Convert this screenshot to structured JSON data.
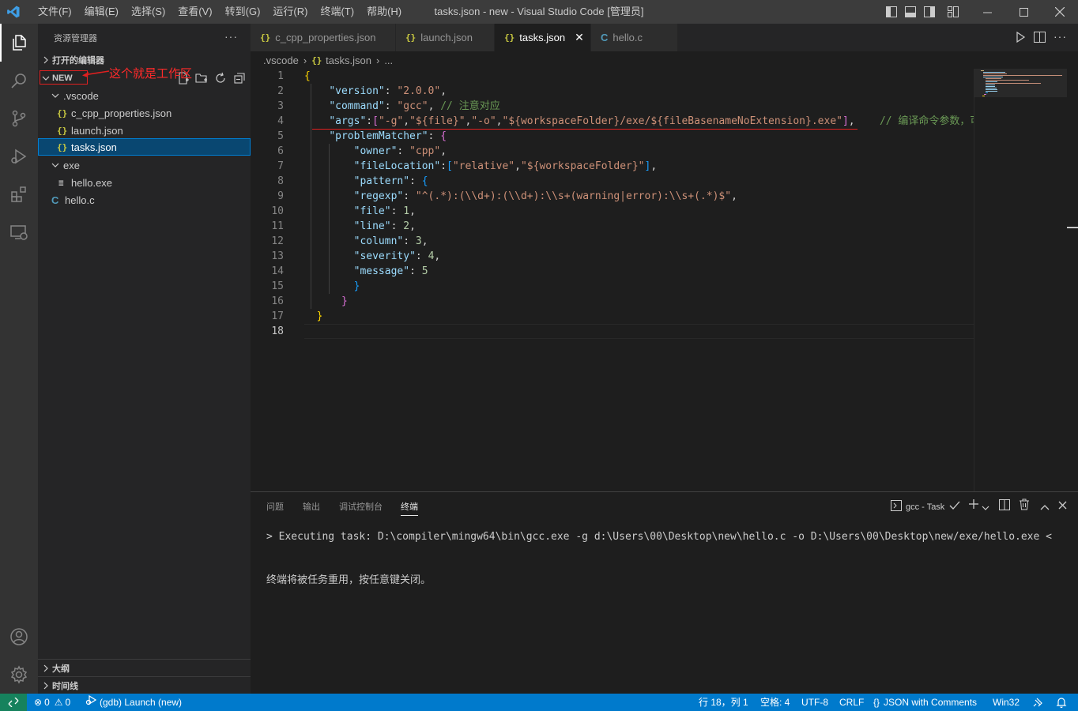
{
  "window": {
    "title": "tasks.json - new - Visual Studio Code [管理员]",
    "menu": [
      "文件(F)",
      "编辑(E)",
      "选择(S)",
      "查看(V)",
      "转到(G)",
      "运行(R)",
      "终端(T)",
      "帮助(H)"
    ]
  },
  "sidebar": {
    "title": "资源管理器",
    "more": "···",
    "open_editors": "打开的编辑器",
    "workspace": "NEW",
    "annotation": "这个就是工作区",
    "tree": [
      {
        "label": ".vscode",
        "type": "folder"
      },
      {
        "label": "c_cpp_properties.json",
        "type": "json"
      },
      {
        "label": "launch.json",
        "type": "json"
      },
      {
        "label": "tasks.json",
        "type": "json",
        "selected": true
      },
      {
        "label": "exe",
        "type": "folder"
      },
      {
        "label": "hello.exe",
        "type": "exe"
      },
      {
        "label": "hello.c",
        "type": "c"
      }
    ],
    "outline": "大纲",
    "timeline": "时间线"
  },
  "tabs": [
    {
      "label": "c_cpp_properties.json",
      "icon": "{}"
    },
    {
      "label": "launch.json",
      "icon": "{}"
    },
    {
      "label": "tasks.json",
      "icon": "{}",
      "active": true,
      "close": "✕"
    },
    {
      "label": "hello.c",
      "icon": "C"
    }
  ],
  "breadcrumb": {
    "folder": ".vscode",
    "file": "tasks.json",
    "more": "..."
  },
  "editor": {
    "line_numbers": [
      "1",
      "2",
      "3",
      "4",
      "5",
      "6",
      "7",
      "8",
      "9",
      "10",
      "11",
      "12",
      "13",
      "14",
      "15",
      "16",
      "17",
      "18"
    ],
    "current_line": "18",
    "comment_line3": "// 注意对应",
    "comment_line4": "// 编译命令参数，可"
  },
  "panel": {
    "tabs": [
      "问题",
      "输出",
      "调试控制台",
      "终端"
    ],
    "active_tab": "终端",
    "task_label": "gcc - Task",
    "terminal_line1": "> Executing task: D:\\compiler\\mingw64\\bin\\gcc.exe -g d:\\Users\\00\\Desktop\\new\\hello.c -o D:\\Users\\00\\Desktop\\new/exe/hello.exe <",
    "terminal_line2": "终端将被任务重用，按任意键关闭。"
  },
  "statusbar": {
    "errors": "0",
    "warnings": "0",
    "debug": "(gdb) Launch (new)",
    "position": "行 18，列 1",
    "spaces": "空格: 4",
    "encoding": "UTF-8",
    "eol": "CRLF",
    "language": "JSON with Comments",
    "platform": "Win32"
  },
  "colors": {
    "accent": "#007acc",
    "annotation_red": "#e02020"
  }
}
